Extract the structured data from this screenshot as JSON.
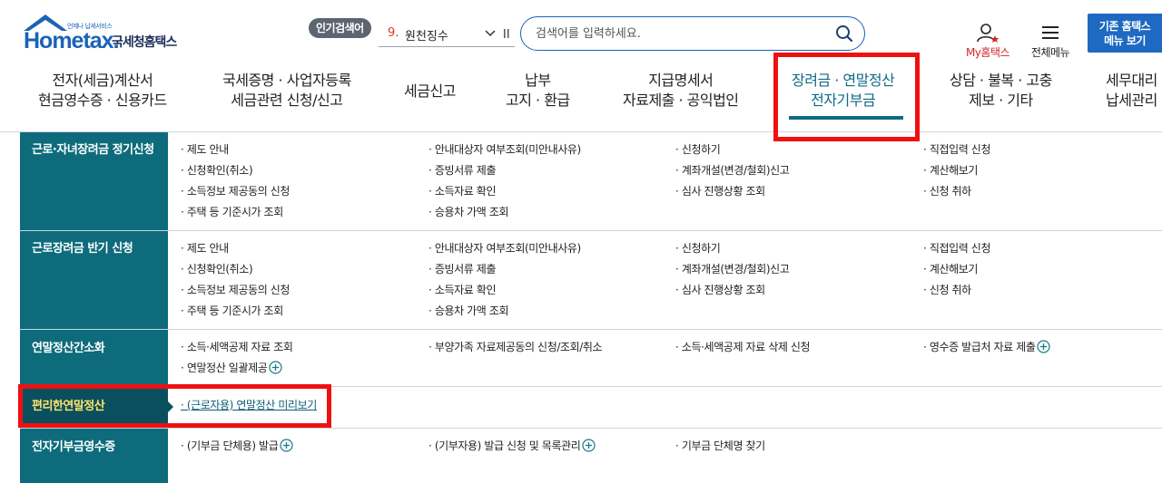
{
  "header": {
    "logo": {
      "brand": "Hometax.",
      "tagline": "언제나 납세서비스",
      "korean": "국세청홈택스"
    },
    "popular_search": {
      "badge": "인기검색어",
      "rank": "9.",
      "keyword": "원천징수"
    },
    "search": {
      "placeholder": "검색어를 입력하세요."
    },
    "my_hometax": "My홈택스",
    "all_menu": "전체메뉴",
    "old_hometax": {
      "line1": "기존 홈택스",
      "line2": "메뉴 보기"
    }
  },
  "nav": [
    {
      "line1": "전자(세금)계산서",
      "line2": "현금영수증 · 신용카드"
    },
    {
      "line1": "국세증명 · 사업자등록",
      "line2": "세금관련 신청/신고"
    },
    {
      "line1": "세금신고",
      "line2": ""
    },
    {
      "line1": "납부",
      "line2": "고지 · 환급"
    },
    {
      "line1": "지급명세서",
      "line2": "자료제출 · 공익법인"
    },
    {
      "line1": "장려금 · 연말정산",
      "line2": "전자기부금",
      "active": true
    },
    {
      "line1": "상담 · 불복 · 고충",
      "line2": "제보 · 기타"
    },
    {
      "line1": "세무대리",
      "line2": "납세관리"
    }
  ],
  "submenu": [
    {
      "category": "근로·자녀장려금 정기신청",
      "links": [
        "· 제도 안내",
        "· 안내대상자 여부조회(미안내사유)",
        "· 신청하기",
        "· 직접입력 신청",
        "· 신청확인(취소)",
        "· 증빙서류 제출",
        "· 계좌개설(변경/철회)신고",
        "· 계산해보기",
        "· 소득정보 제공동의 신청",
        "· 소득자료 확인",
        "· 심사 진행상황 조회",
        "· 신청 취하",
        "· 주택 등 기준시가 조회",
        "· 승용차 가액 조회"
      ]
    },
    {
      "category": "근로장려금 반기 신청",
      "links": [
        "· 제도 안내",
        "· 안내대상자 여부조회(미안내사유)",
        "· 신청하기",
        "· 직접입력 신청",
        "· 신청확인(취소)",
        "· 증빙서류 제출",
        "· 계좌개설(변경/철회)신고",
        "· 계산해보기",
        "· 소득정보 제공동의 신청",
        "· 소득자료 확인",
        "· 심사 진행상황 조회",
        "· 신청 취하",
        "· 주택 등 기준시가 조회",
        "· 승용차 가액 조회"
      ]
    },
    {
      "category": "연말정산간소화",
      "links": [
        "· 소득·세액공제 자료 조회",
        "· 부양가족 자료제공동의 신청/조회/취소",
        "· 소득·세액공제 자료 삭제 신청",
        "· 영수증 발급처 자료 제출",
        "· 연말정산 일괄제공"
      ]
    },
    {
      "category": "편리한연말정산",
      "selected": true,
      "links": [
        "· (근로자용) 연말정산 미리보기"
      ]
    },
    {
      "category": "전자기부금영수증",
      "links": [
        "· (기부금 단체용) 발급",
        "· (기부자용) 발급 신청 및 목록관리",
        "· 기부금 단체명 찾기"
      ]
    }
  ],
  "colors": {
    "brand_blue": "#1a63b8",
    "category_teal": "#0d6b7c",
    "selected_category": "#0a4f5e",
    "selected_text_yellow": "#ffe36b",
    "annotation_red": "#ee1111"
  }
}
